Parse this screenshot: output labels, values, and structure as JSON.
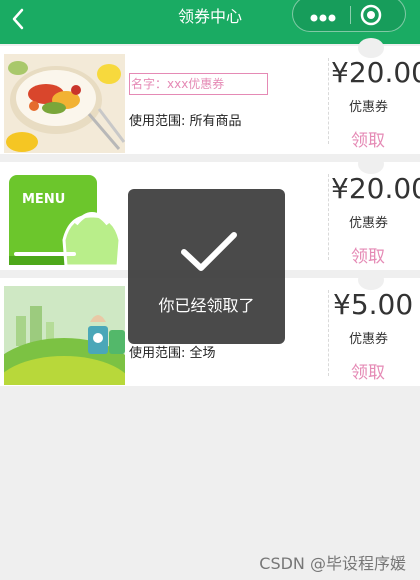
{
  "header": {
    "title": "领券中心",
    "background": "#1aab63"
  },
  "coupons": [
    {
      "name": "名字：xxx优惠券",
      "scope": "使用范围: 所有商品",
      "amount": "¥20.00",
      "unit": "优惠券",
      "claim": "领取",
      "image": "food-plate"
    },
    {
      "name": "",
      "scope": "",
      "amount": "¥20.00",
      "unit": "优惠券",
      "claim": "领取",
      "image": "menu-logo",
      "image_text": "MENU"
    },
    {
      "name": "",
      "scope": "使用范围: 全场",
      "amount": "¥5.00",
      "unit": "优惠券",
      "claim": "领取",
      "image": "green-bins"
    }
  ],
  "toast": {
    "message": "你已经领取了",
    "icon": "checkmark-icon"
  },
  "watermark": "CSDN @毕设程序媛",
  "colors": {
    "accent_pink": "#e58ab5",
    "toast_bg": "#3c3c3c"
  }
}
